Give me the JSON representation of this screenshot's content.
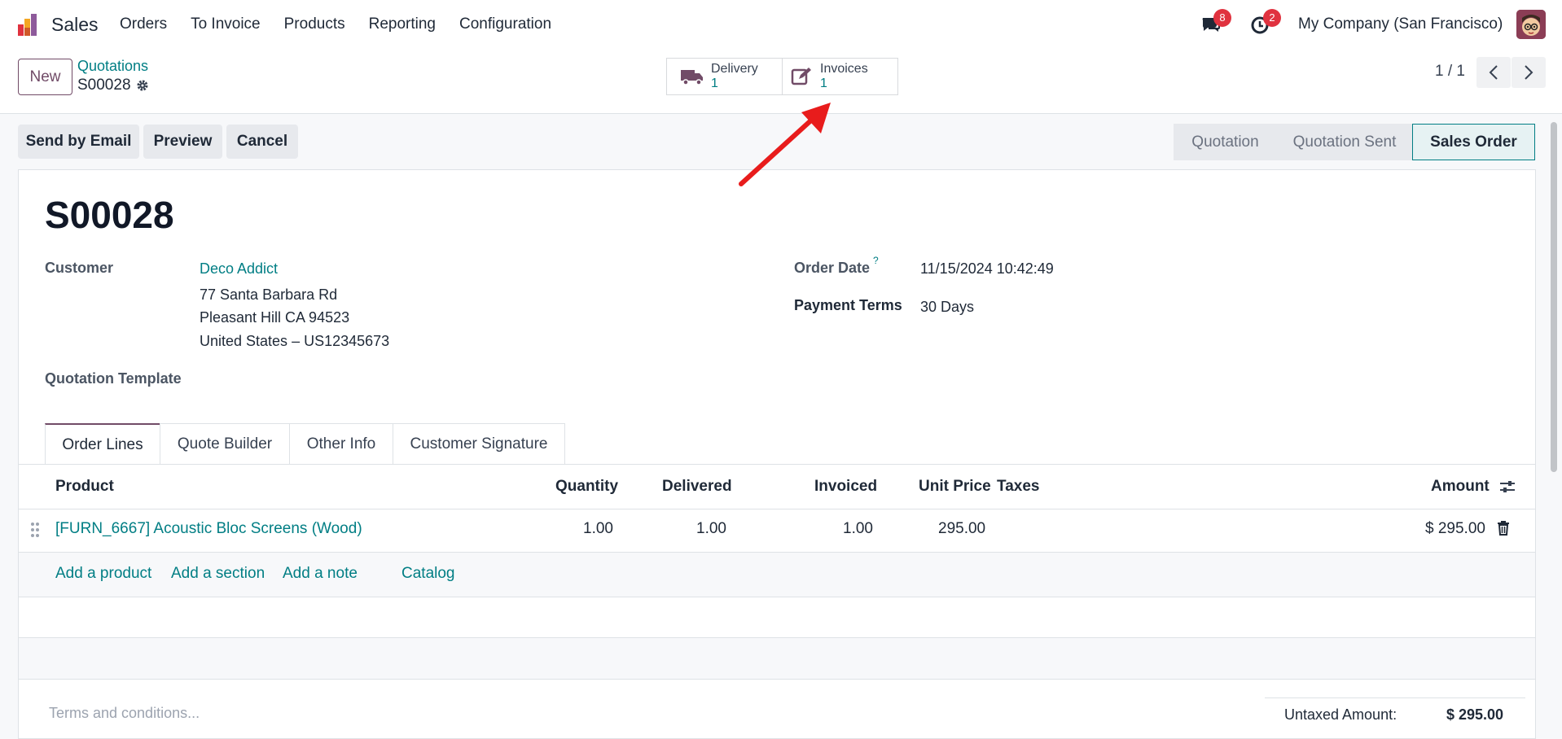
{
  "app": {
    "name": "Sales"
  },
  "menu": [
    "Orders",
    "To Invoice",
    "Products",
    "Reporting",
    "Configuration"
  ],
  "systray": {
    "messages_count": "8",
    "activities_count": "2",
    "company": "My Company (San Francisco)"
  },
  "control": {
    "new_label": "New",
    "breadcrumb_parent": "Quotations",
    "breadcrumb_current": "S00028",
    "smart_buttons": [
      {
        "label": "Delivery",
        "count": "1"
      },
      {
        "label": "Invoices",
        "count": "1"
      }
    ],
    "pager": "1 / 1"
  },
  "actions": [
    "Send by Email",
    "Preview",
    "Cancel"
  ],
  "status": [
    "Quotation",
    "Quotation Sent",
    "Sales Order"
  ],
  "status_active": "Sales Order",
  "form": {
    "title": "S00028",
    "customer_label": "Customer",
    "customer_name": "Deco Addict",
    "address_line1": "77 Santa Barbara Rd",
    "address_line2": "Pleasant Hill CA 94523",
    "address_line3": "United States – US12345673",
    "template_label": "Quotation Template",
    "order_date_label": "Order Date",
    "order_date_help": "?",
    "order_date": "11/15/2024 10:42:49",
    "payment_terms_label": "Payment Terms",
    "payment_terms": "30 Days"
  },
  "tabs": [
    "Order Lines",
    "Quote Builder",
    "Other Info",
    "Customer Signature"
  ],
  "table": {
    "headers": {
      "product": "Product",
      "quantity": "Quantity",
      "delivered": "Delivered",
      "invoiced": "Invoiced",
      "unit_price": "Unit Price",
      "taxes": "Taxes",
      "amount": "Amount"
    },
    "rows": [
      {
        "product": "[FURN_6667] Acoustic Bloc Screens (Wood)",
        "quantity": "1.00",
        "delivered": "1.00",
        "invoiced": "1.00",
        "unit_price": "295.00",
        "taxes": "",
        "amount": "$ 295.00"
      }
    ],
    "add_links": [
      "Add a product",
      "Add a section",
      "Add a note",
      "Catalog"
    ]
  },
  "footer": {
    "terms_placeholder": "Terms and conditions...",
    "untaxed_label": "Untaxed Amount:",
    "untaxed_value": "$ 295.00"
  },
  "colors": {
    "brand": "#714b67",
    "link": "#017e84",
    "badge": "#e0323f",
    "annotation_arrow": "#e81c1c"
  }
}
